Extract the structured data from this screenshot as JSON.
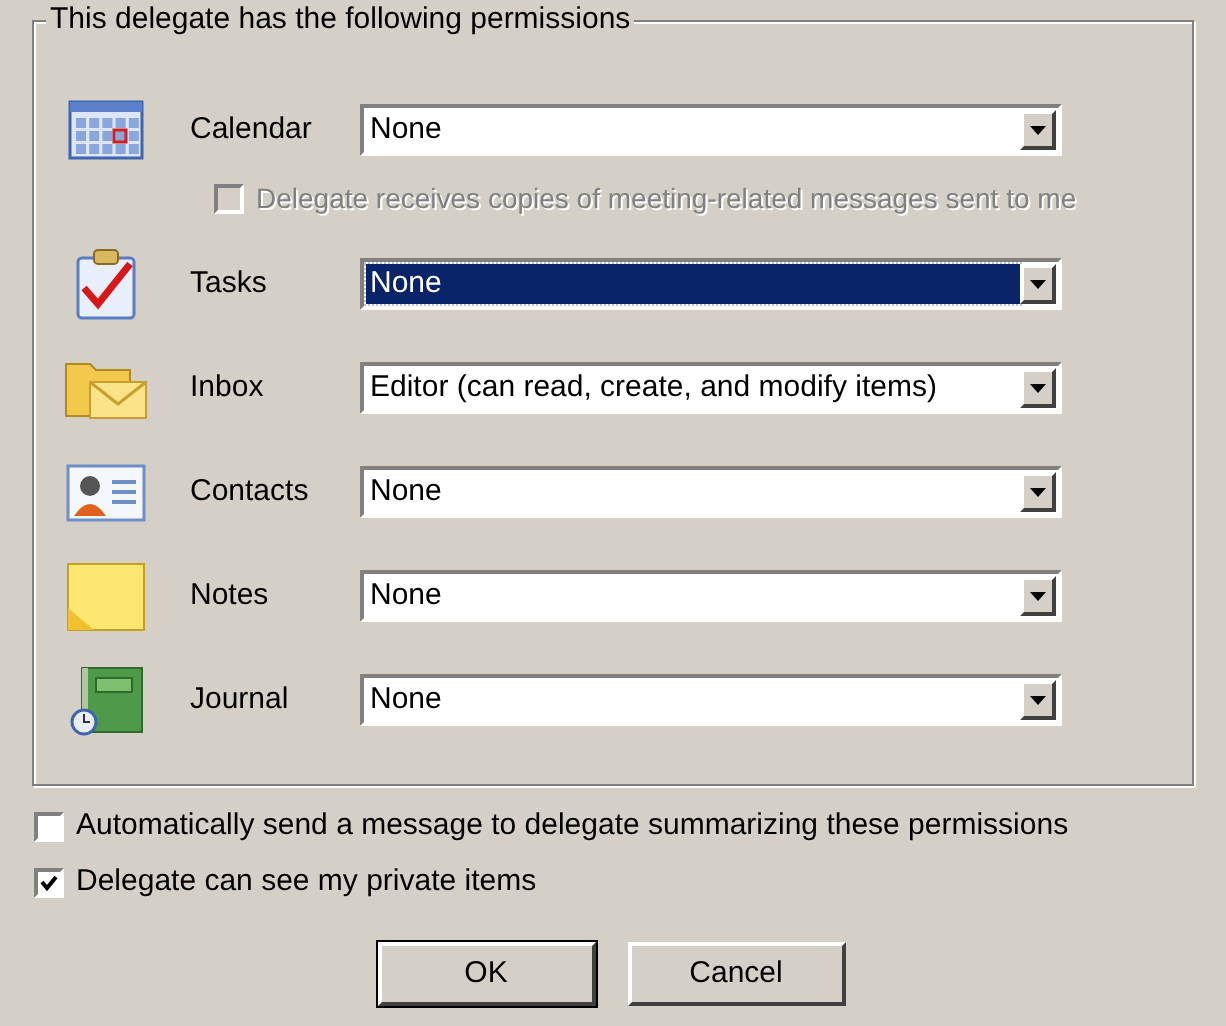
{
  "group": {
    "title": "This delegate has the following permissions"
  },
  "folders": [
    {
      "kind": "calendar",
      "label": "Calendar",
      "value": "None",
      "selected": false,
      "option": {
        "label": "Delegate receives copies of meeting-related messages sent to me",
        "checked": false,
        "disabled": true
      }
    },
    {
      "kind": "tasks",
      "label": "Tasks",
      "value": "None",
      "selected": true
    },
    {
      "kind": "inbox",
      "label": "Inbox",
      "value": "Editor (can read, create, and modify items)",
      "selected": false
    },
    {
      "kind": "contacts",
      "label": "Contacts",
      "value": "None",
      "selected": false
    },
    {
      "kind": "notes",
      "label": "Notes",
      "value": "None",
      "selected": false
    },
    {
      "kind": "journal",
      "label": "Journal",
      "value": "None",
      "selected": false
    }
  ],
  "options": [
    {
      "label": "Automatically send a message to delegate summarizing these permissions",
      "checked": false
    },
    {
      "label": "Delegate can see my private items",
      "checked": true
    }
  ],
  "buttons": [
    {
      "label": "OK",
      "default": true
    },
    {
      "label": "Cancel",
      "default": false
    }
  ]
}
